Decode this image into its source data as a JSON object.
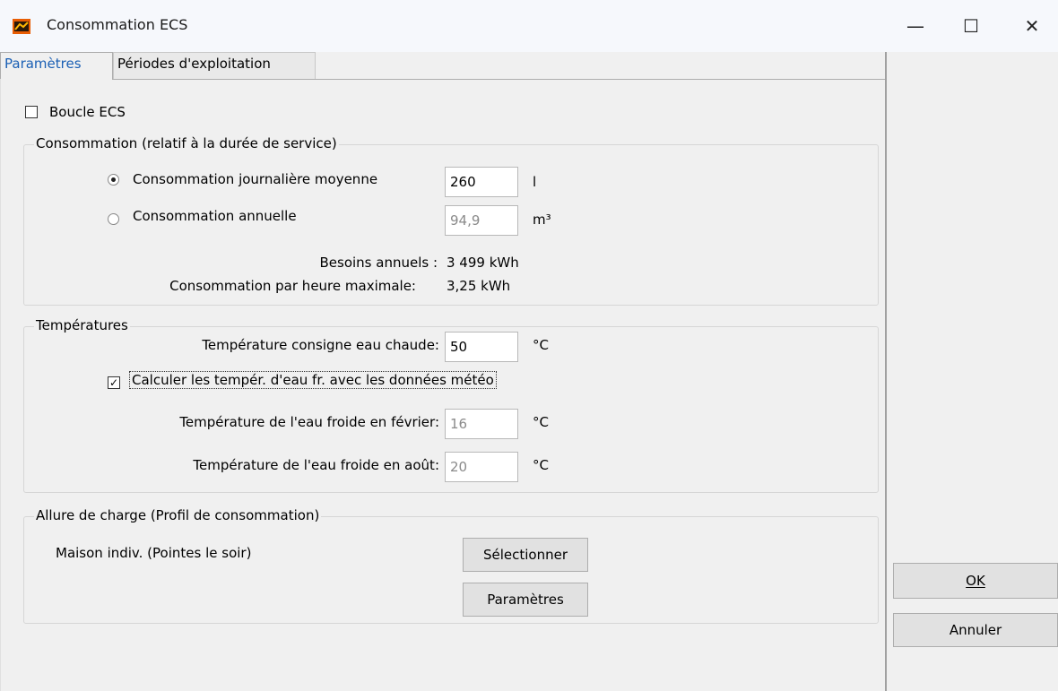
{
  "window": {
    "title": "Consommation ECS",
    "minimize": "—",
    "maximize": "☐",
    "close": "✕"
  },
  "tabs": [
    "Paramètres",
    "Périodes d'exploitation"
  ],
  "boucle": {
    "label": "Boucle ECS",
    "checked": false
  },
  "consommation": {
    "title": "Consommation (relatif à la durée de service)",
    "journaliere": {
      "label": "Consommation journalière moyenne",
      "value": "260",
      "unit": "l",
      "selected": true
    },
    "annuelle": {
      "label": "Consommation annuelle",
      "value": "94,9",
      "unit": "m³",
      "selected": false
    },
    "besoins_label": "Besoins annuels :",
    "besoins_value": "3 499 kWh",
    "heure_max_label": "Consommation par heure maximale:",
    "heure_max_value": "3,25 kWh"
  },
  "temperatures": {
    "title": "Températures",
    "consigne_label": "Température consigne eau chaude:",
    "consigne_value": "50",
    "consigne_unit": "°C",
    "calc_label": "Calculer les tempér. d'eau fr. avec les données météo",
    "calc_checked": true,
    "fevrier_label": "Température de l'eau froide en février:",
    "fevrier_value": "16",
    "fevrier_unit": "°C",
    "aout_label": "Température de l'eau froide en août:",
    "aout_value": "20",
    "aout_unit": "°C"
  },
  "allure": {
    "title": "Allure de charge (Profil de consommation)",
    "profile": "Maison indiv. (Pointes le soir)",
    "select_button": "Sélectionner",
    "params_button": "Paramètres"
  },
  "buttons": {
    "ok": "OK",
    "cancel": "Annuler"
  }
}
